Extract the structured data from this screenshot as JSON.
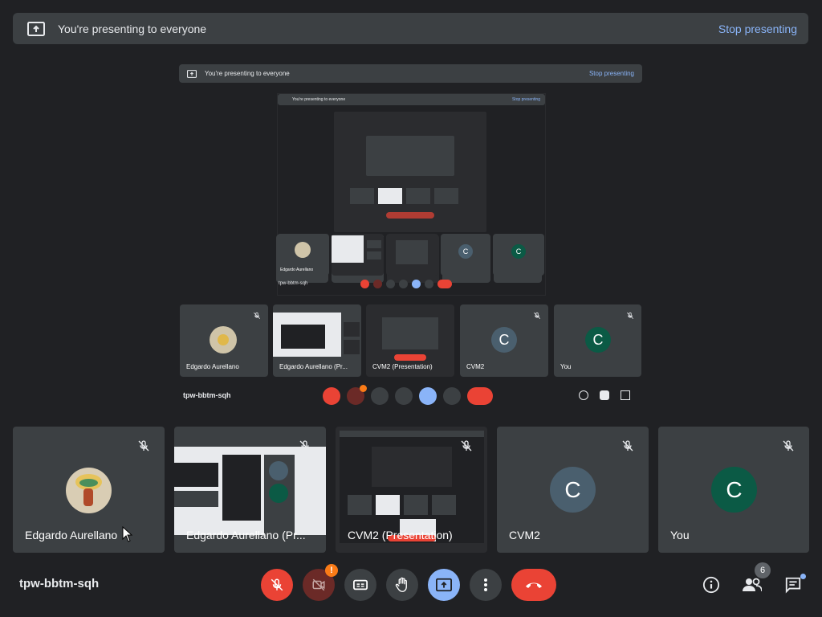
{
  "banner": {
    "text": "You're presenting to everyone",
    "stop_label": "Stop presenting"
  },
  "tiles": [
    {
      "name": "Edgardo Aurellano",
      "muted": true,
      "kind": "photo"
    },
    {
      "name": "Edgardo Aurellano (Pr...",
      "muted": true,
      "kind": "screen"
    },
    {
      "name": "CVM2 (Presentation)",
      "muted": true,
      "kind": "screen"
    },
    {
      "name": "CVM2",
      "muted": true,
      "kind": "avatar",
      "initial": "C",
      "color": "#4a5f6e"
    },
    {
      "name": "You",
      "muted": true,
      "kind": "avatar",
      "initial": "C",
      "color": "#0b5a45"
    }
  ],
  "meeting": {
    "code": "tpw-bbtm-sqh",
    "participant_count": "6",
    "camera_alert": "!"
  },
  "colors": {
    "accent": "#8ab4f8",
    "danger": "#ea4335",
    "surface": "#3c4043",
    "background": "#202124"
  }
}
